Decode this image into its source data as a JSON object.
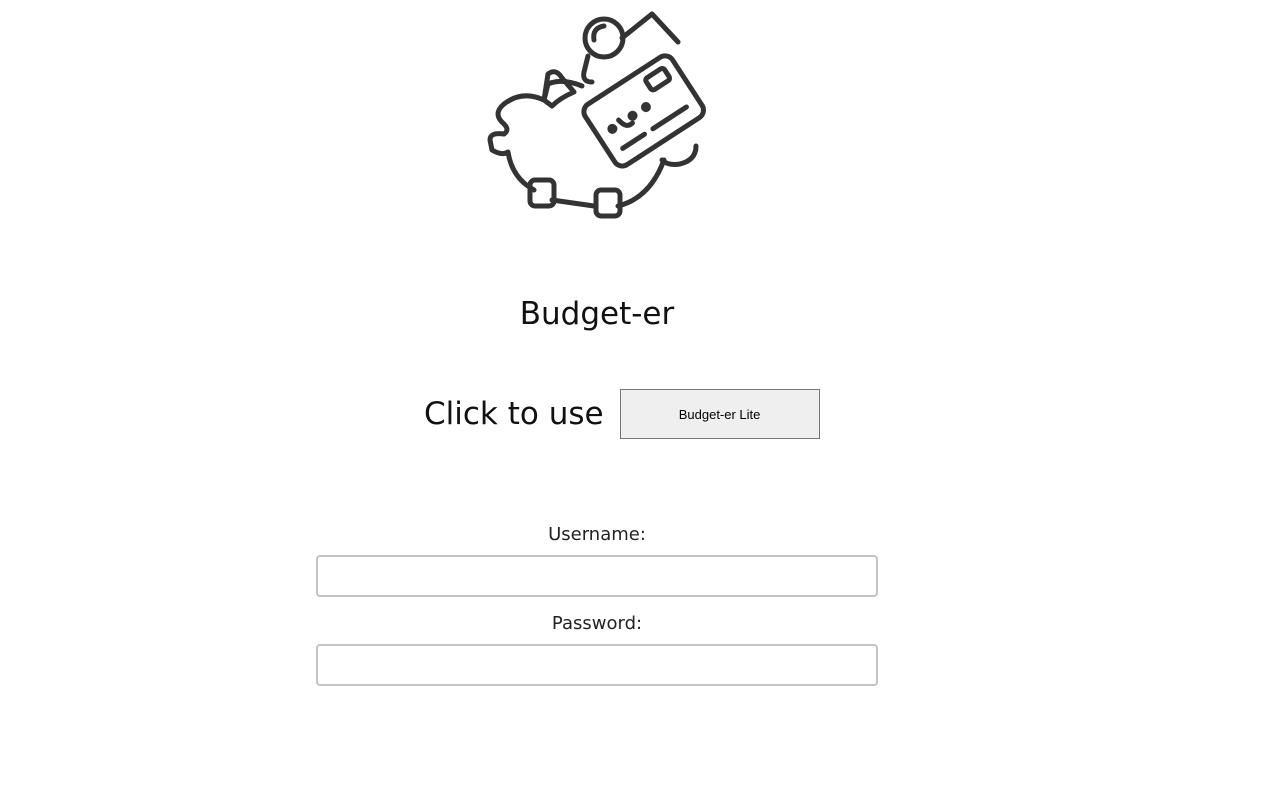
{
  "app": {
    "title": "Budget-er",
    "logo_icon": "piggy-bank-credit-card-icon"
  },
  "lite": {
    "prompt": "Click to use",
    "button_label": "Budget-er Lite"
  },
  "login": {
    "username_label": "Username:",
    "username_value": "",
    "password_label": "Password:",
    "password_value": ""
  },
  "colors": {
    "icon_stroke": "#333333",
    "button_bg": "#efefef",
    "input_border": "#c4c4c4"
  }
}
